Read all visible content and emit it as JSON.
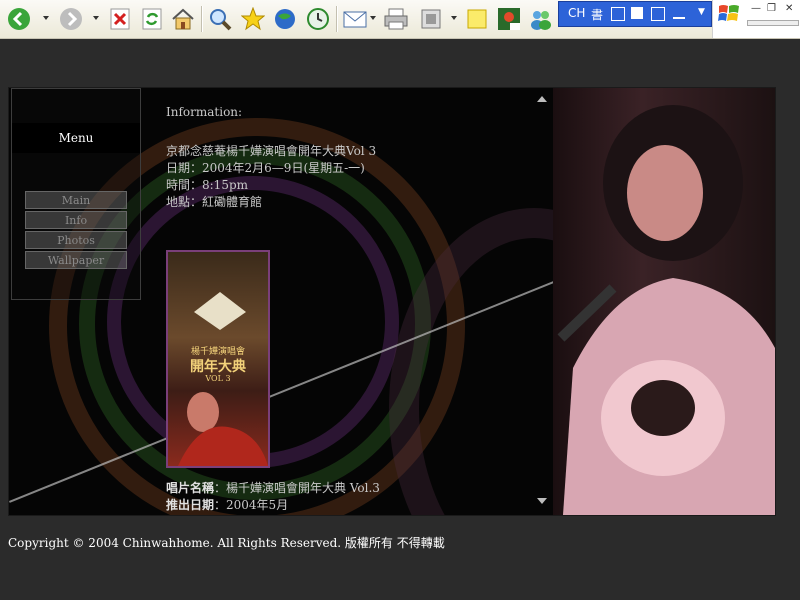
{
  "browser": {
    "toolbar_buttons": [
      "back-icon",
      "forward-icon",
      "stop-icon",
      "refresh-icon",
      "home-icon",
      "search-icon",
      "favorites-icon",
      "media-icon",
      "history-icon",
      "mail-icon",
      "print-icon",
      "edit-icon",
      "notes-icon",
      "messenger-icon",
      "contacts-icon"
    ],
    "ime": {
      "lang": "CH",
      "mode": "書"
    }
  },
  "site": {
    "menu": {
      "title": "Menu",
      "items": [
        "Main",
        "Info",
        "Photos",
        "Wallpaper"
      ]
    },
    "information": {
      "heading": "Information:",
      "lines": [
        "京都念慈菴楊千嬅演唱會開年大典Vol 3",
        "日期：2004年2月6—9日(星期五-一)",
        "時間：8:15pm",
        "地點：紅磡體育館"
      ]
    },
    "cover": {
      "line1": "楊千嬅演唱會",
      "line2": "開年大典",
      "line3": "VOL 3"
    },
    "album": {
      "name_label": "唱片名稱",
      "name_value": "：楊千嬅演唱會開年大典 Vol.3",
      "date_label": "推出日期",
      "date_value": "：2004年5月"
    }
  },
  "footer": {
    "copyright": "Copyright © 2004 Chinwahhome. All Rights Reserved. 版權所有 不得轉載"
  }
}
